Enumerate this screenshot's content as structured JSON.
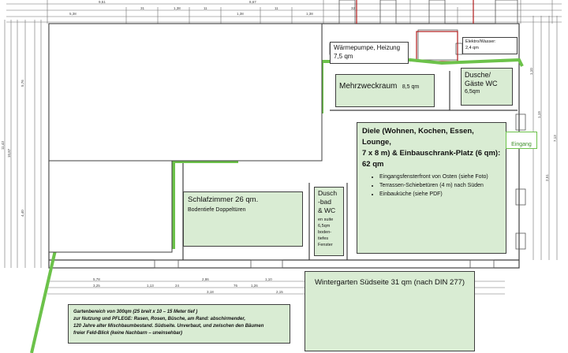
{
  "rooms": {
    "waermepumpe": {
      "label": "Wärmepumpe, Heizung",
      "area": "7,5 qm"
    },
    "elektro": {
      "label": "Elektro/Wasser:",
      "area": "2,4 qm"
    },
    "mehrzweck": {
      "label": "Mehrzweckraum",
      "area": "8,5 qm"
    },
    "dusche_gaeste": {
      "line1": "Dusche/",
      "line2": "Gäste WC",
      "area": "6,5qm"
    },
    "diele": {
      "line1": "Diele (Wohnen, Kochen, Essen, Lounge,",
      "line2": "7 x 8 m) & Einbauschrank-Platz (6 qm):",
      "line3": "62 qm",
      "bullets": [
        "Eingangsfensterfront von Osten (siehe Foto)",
        "Terrassen-Schiebetüren (4 m) nach Süden",
        "Einbauküche (siehe PDF)"
      ]
    },
    "eingang": {
      "label": "Eingang"
    },
    "schlafzimmer": {
      "label": "Schlafzimmer 26 qm.",
      "sub": "Bodentiefe Doppeltüren"
    },
    "duschbad": {
      "title_lines": [
        "Dusch",
        "-bad",
        "& WC"
      ],
      "sub_lines": [
        "en suite",
        "6,5qm",
        "boden-",
        "tiefes",
        "Fenster"
      ]
    },
    "wintergarten": {
      "label": "Wintergarten Südseite 31 qm (nach DIN 277)"
    }
  },
  "garden": {
    "lines": [
      "Gartenbereich von 300qm (25 breit  x 10 – 15  Meter tief )",
      "zur Nutzung und PFLEGE: Rasen, Rosen, Büsche,  am Rand: abschirmender,",
      "120 Jahre alter Mischbaumbestand. Südseite. Unverbaut, und zwischen den Bäumen",
      "freier Feld-Blick (keine Nachbarn – uneinsehbar)"
    ]
  },
  "dimensions": {
    "top_row1": [
      "9,51",
      "8,67"
    ],
    "top_row2": [
      "5,38",
      "31",
      "1,38",
      "11",
      "1,38",
      "11",
      "1,38",
      "32"
    ],
    "left_labels": [
      "11,43",
      "10,87",
      "5,76",
      "4,40"
    ],
    "bottom_row1": [
      "5,78",
      "2,86",
      "1,10",
      "4,05"
    ],
    "bottom_row2": [
      "3,25",
      "1,13",
      "3,18",
      "24",
      "1,26",
      "76",
      "2,15"
    ],
    "right_labels": [
      "1,10",
      "1,19",
      "2,51",
      "7,13"
    ]
  },
  "colors": {
    "green_fill": "#d9ecd3",
    "green_line": "#6cc24a",
    "wall": "#3f3f3f",
    "dim_line": "#6d6d6d",
    "accent_red": "#b11c1c"
  }
}
